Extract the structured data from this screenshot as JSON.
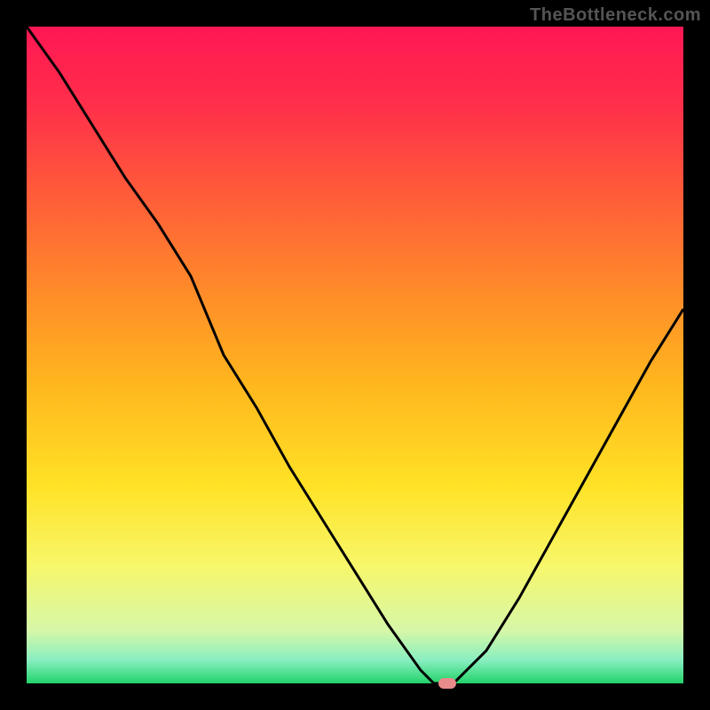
{
  "watermark": "TheBottleneck.com",
  "chart_data": {
    "type": "line",
    "title": "",
    "xlabel": "",
    "ylabel": "",
    "xlim": [
      0,
      100
    ],
    "ylim": [
      0,
      100
    ],
    "x": [
      0,
      5,
      10,
      15,
      20,
      25,
      30,
      35,
      40,
      45,
      50,
      55,
      60,
      62,
      65,
      70,
      75,
      80,
      85,
      90,
      95,
      100
    ],
    "y": [
      100,
      93,
      85,
      77,
      70,
      62,
      50,
      42,
      33,
      25,
      17,
      9,
      2,
      0,
      0,
      5,
      13,
      22,
      31,
      40,
      49,
      57
    ],
    "min_marker": {
      "x": 64,
      "y": 0,
      "color": "#e88b8b"
    },
    "green_band": {
      "y_from": 0,
      "y_to": 3
    }
  },
  "colors": {
    "gradient_stops": [
      {
        "pos": 0.0,
        "color": "#ff1754"
      },
      {
        "pos": 0.12,
        "color": "#ff2f4a"
      },
      {
        "pos": 0.25,
        "color": "#ff5a3a"
      },
      {
        "pos": 0.4,
        "color": "#ff8a2a"
      },
      {
        "pos": 0.55,
        "color": "#ffb81e"
      },
      {
        "pos": 0.7,
        "color": "#ffe226"
      },
      {
        "pos": 0.82,
        "color": "#f7f76a"
      },
      {
        "pos": 0.92,
        "color": "#d6f7a8"
      },
      {
        "pos": 0.965,
        "color": "#88eec0"
      },
      {
        "pos": 1.0,
        "color": "#22d36a"
      }
    ],
    "curve": "#000000",
    "marker": "#e88b8b",
    "frame": "#000000"
  }
}
